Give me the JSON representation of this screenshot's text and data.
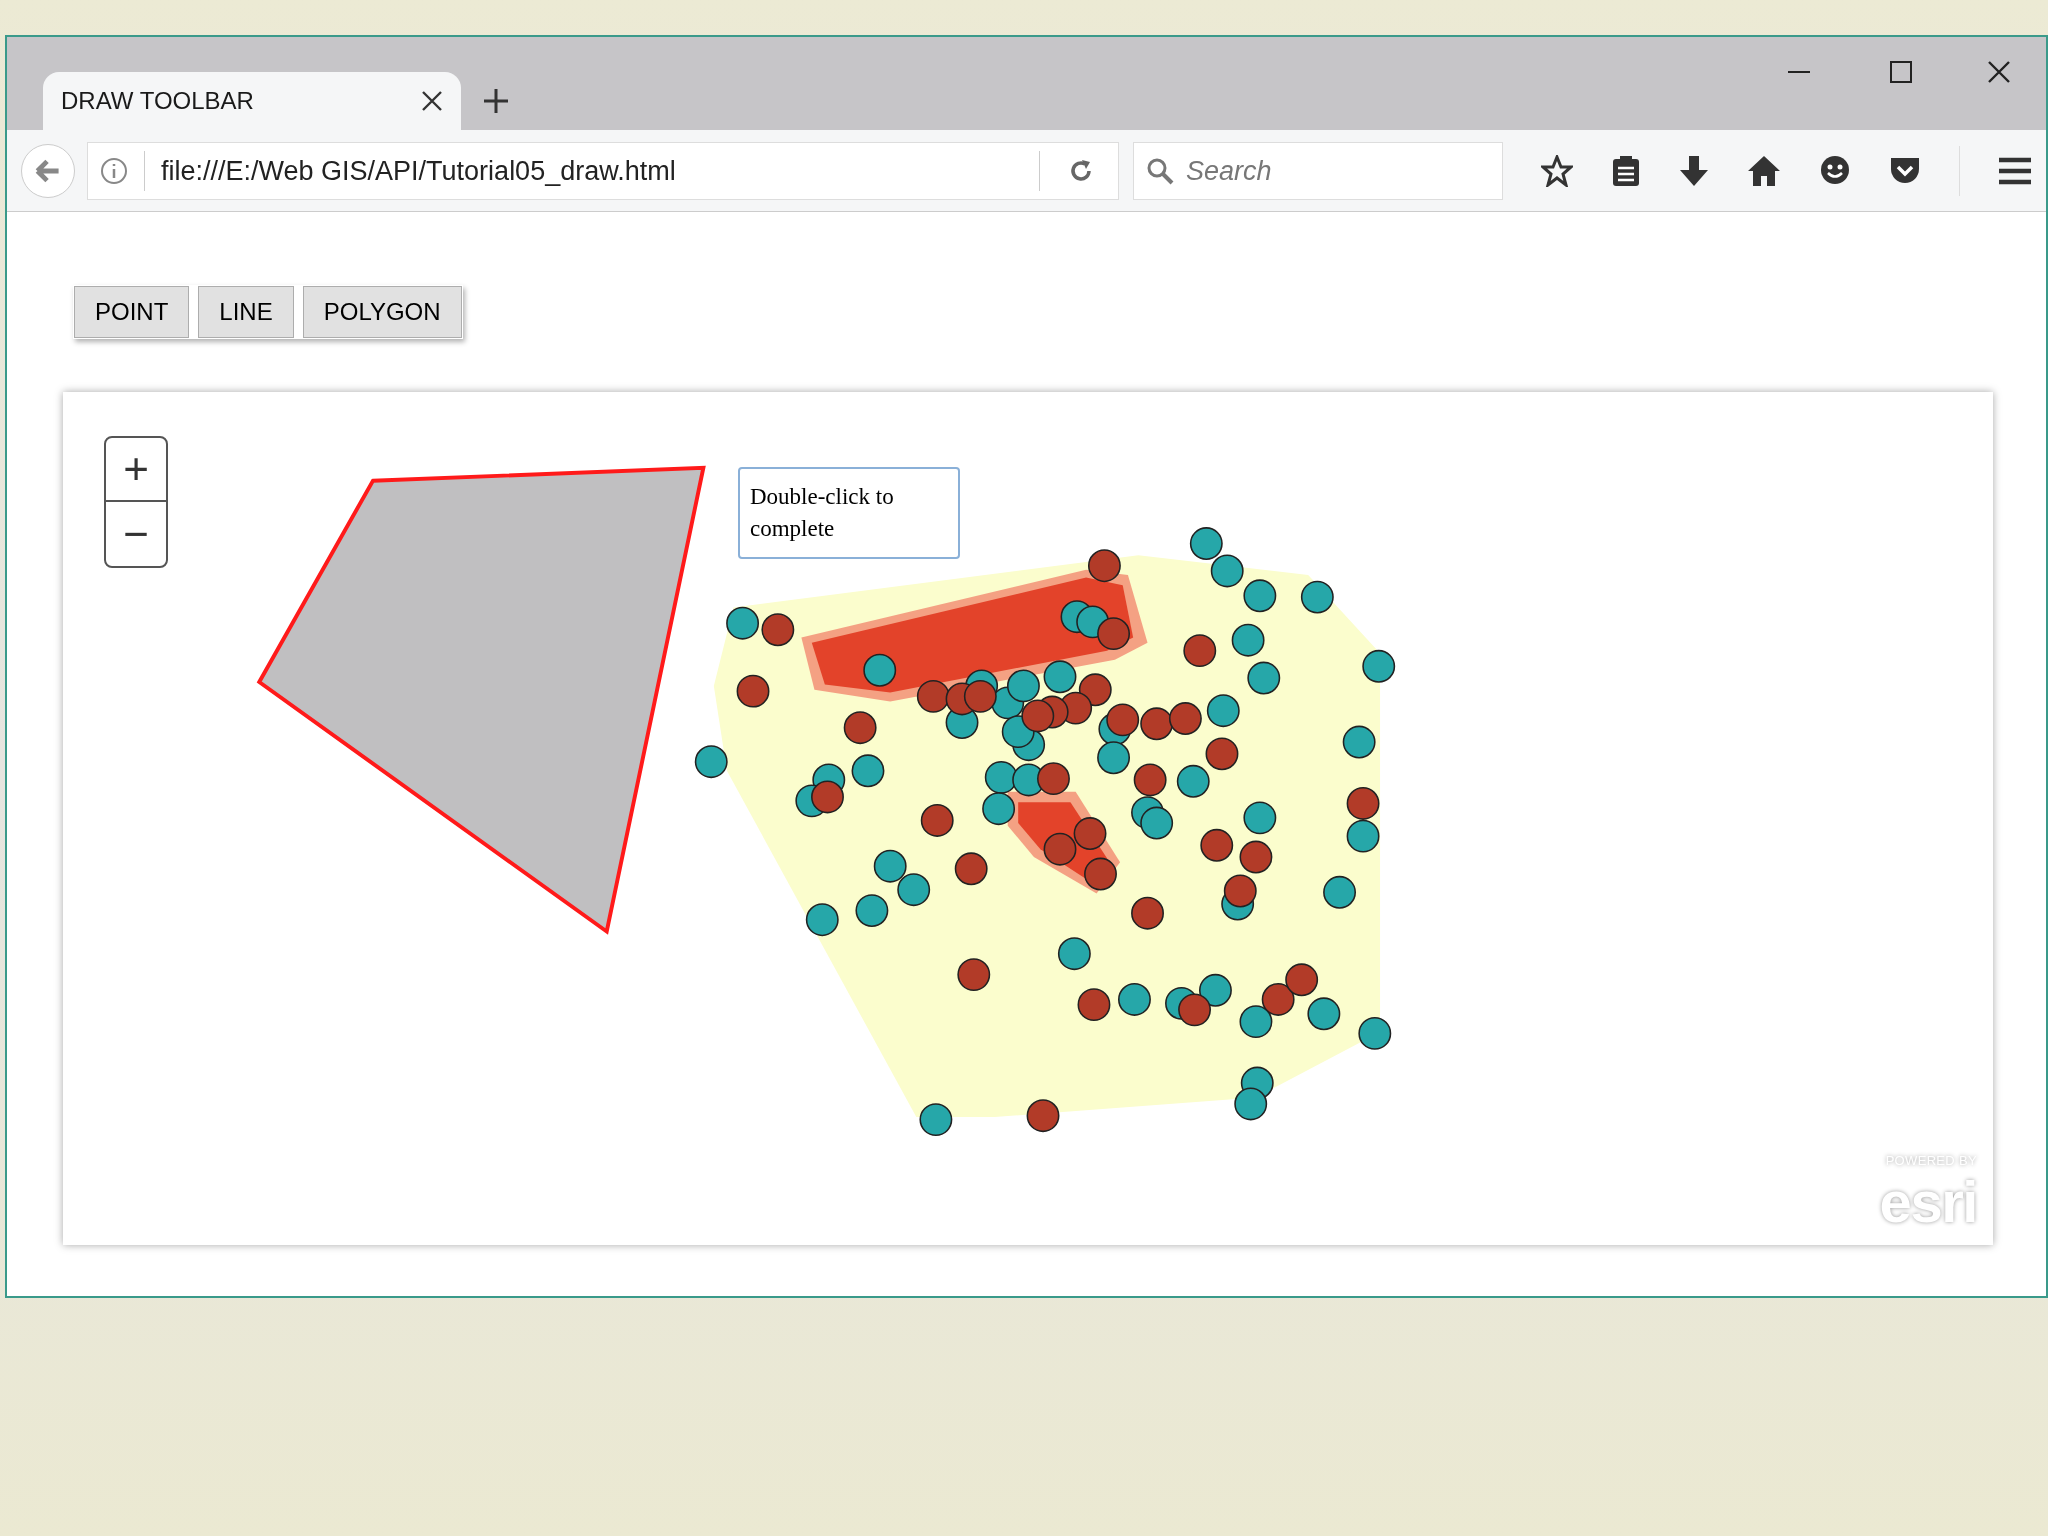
{
  "browser": {
    "tab": {
      "title": "DRAW TOOLBAR"
    },
    "url": "file:///E:/Web GIS/API/Tutorial05_draw.html",
    "search": {
      "placeholder": "Search"
    }
  },
  "toolbar": {
    "buttons": [
      "POINT",
      "LINE",
      "POLYGON"
    ]
  },
  "map": {
    "zoom_in": "+",
    "zoom_out": "−",
    "tooltip": "Double-click to complete",
    "logo": {
      "tagline": "POWERED BY",
      "wordmark": "esri"
    }
  }
}
